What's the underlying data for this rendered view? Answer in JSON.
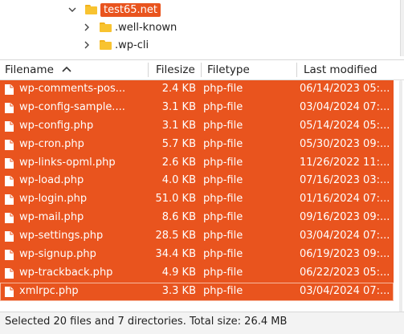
{
  "tree": {
    "items": [
      {
        "label": "test65.net",
        "expanded": true,
        "selected": true
      },
      {
        "label": ".well-known",
        "expanded": false,
        "selected": false
      },
      {
        "label": ".wp-cli",
        "expanded": false,
        "selected": false
      }
    ]
  },
  "list": {
    "columns": {
      "name": "Filename",
      "size": "Filesize",
      "type": "Filetype",
      "modified": "Last modified"
    },
    "sort": {
      "column": "name",
      "direction": "ascending"
    },
    "rows": [
      {
        "name": "wp-comments-pos...",
        "size": "2.4 KB",
        "type": "php-file",
        "modified": "06/14/2023 05:..."
      },
      {
        "name": "wp-config-sample....",
        "size": "3.1 KB",
        "type": "php-file",
        "modified": "03/04/2024 07:..."
      },
      {
        "name": "wp-config.php",
        "size": "3.1 KB",
        "type": "php-file",
        "modified": "05/14/2024 05:..."
      },
      {
        "name": "wp-cron.php",
        "size": "5.7 KB",
        "type": "php-file",
        "modified": "05/30/2023 09:..."
      },
      {
        "name": "wp-links-opml.php",
        "size": "2.6 KB",
        "type": "php-file",
        "modified": "11/26/2022 11:..."
      },
      {
        "name": "wp-load.php",
        "size": "4.0 KB",
        "type": "php-file",
        "modified": "07/16/2023 03:..."
      },
      {
        "name": "wp-login.php",
        "size": "51.0 KB",
        "type": "php-file",
        "modified": "01/16/2024 07:..."
      },
      {
        "name": "wp-mail.php",
        "size": "8.6 KB",
        "type": "php-file",
        "modified": "09/16/2023 09:..."
      },
      {
        "name": "wp-settings.php",
        "size": "28.5 KB",
        "type": "php-file",
        "modified": "03/04/2024 07:..."
      },
      {
        "name": "wp-signup.php",
        "size": "34.4 KB",
        "type": "php-file",
        "modified": "06/19/2023 09:..."
      },
      {
        "name": "wp-trackback.php",
        "size": "4.9 KB",
        "type": "php-file",
        "modified": "06/22/2023 05:..."
      },
      {
        "name": "xmlrpc.php",
        "size": "3.3 KB",
        "type": "php-file",
        "modified": "03/04/2024 07:..."
      }
    ]
  },
  "status": {
    "text": "Selected 20 files and 7 directories. Total size: 26.4 MB"
  },
  "colors": {
    "selection": "#e9541e",
    "folder": "#f8c330"
  }
}
